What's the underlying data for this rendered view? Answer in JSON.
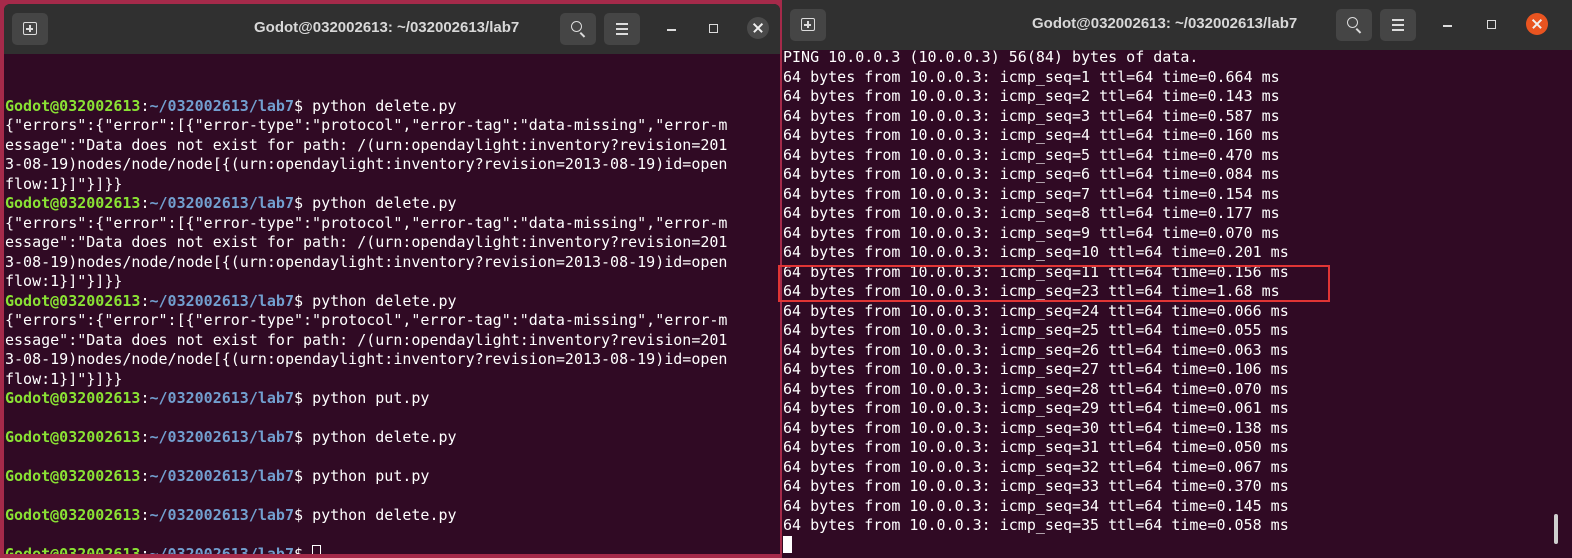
{
  "left_window": {
    "title": "Godot@032002613: ~/032002613/lab7",
    "prompt_user": "Godot@032002613",
    "prompt_sep": ":",
    "prompt_path": "~/032002613/lab7",
    "prompt_suffix": "$ ",
    "lines": [
      {
        "kind": "blank"
      },
      {
        "kind": "prompt",
        "cmd": "python delete.py"
      },
      {
        "kind": "output",
        "text": "{\"errors\":{\"error\":[{\"error-type\":\"protocol\",\"error-tag\":\"data-missing\",\"error-m"
      },
      {
        "kind": "output",
        "text": "essage\":\"Data does not exist for path: /(urn:opendaylight:inventory?revision=201"
      },
      {
        "kind": "output",
        "text": "3-08-19)nodes/node/node[{(urn:opendaylight:inventory?revision=2013-08-19)id=open"
      },
      {
        "kind": "output",
        "text": "flow:1}]\"}]}}"
      },
      {
        "kind": "prompt",
        "cmd": "python delete.py"
      },
      {
        "kind": "output",
        "text": "{\"errors\":{\"error\":[{\"error-type\":\"protocol\",\"error-tag\":\"data-missing\",\"error-m"
      },
      {
        "kind": "output",
        "text": "essage\":\"Data does not exist for path: /(urn:opendaylight:inventory?revision=201"
      },
      {
        "kind": "output",
        "text": "3-08-19)nodes/node/node[{(urn:opendaylight:inventory?revision=2013-08-19)id=open"
      },
      {
        "kind": "output",
        "text": "flow:1}]\"}]}}"
      },
      {
        "kind": "prompt",
        "cmd": "python delete.py"
      },
      {
        "kind": "output",
        "text": "{\"errors\":{\"error\":[{\"error-type\":\"protocol\",\"error-tag\":\"data-missing\",\"error-m"
      },
      {
        "kind": "output",
        "text": "essage\":\"Data does not exist for path: /(urn:opendaylight:inventory?revision=201"
      },
      {
        "kind": "output",
        "text": "3-08-19)nodes/node/node[{(urn:opendaylight:inventory?revision=2013-08-19)id=open"
      },
      {
        "kind": "output",
        "text": "flow:1}]\"}]}}"
      },
      {
        "kind": "prompt",
        "cmd": "python put.py"
      },
      {
        "kind": "blank"
      },
      {
        "kind": "prompt",
        "cmd": "python delete.py"
      },
      {
        "kind": "blank"
      },
      {
        "kind": "prompt",
        "cmd": "python put.py"
      },
      {
        "kind": "blank"
      },
      {
        "kind": "prompt",
        "cmd": "python delete.py"
      },
      {
        "kind": "blank"
      },
      {
        "kind": "prompt",
        "cmd": "",
        "cursor": true
      }
    ]
  },
  "right_window": {
    "title": "Godot@032002613: ~/032002613/lab7",
    "lines": [
      "PING 10.0.0.3 (10.0.0.3) 56(84) bytes of data.",
      "64 bytes from 10.0.0.3: icmp_seq=1 ttl=64 time=0.664 ms",
      "64 bytes from 10.0.0.3: icmp_seq=2 ttl=64 time=0.143 ms",
      "64 bytes from 10.0.0.3: icmp_seq=3 ttl=64 time=0.587 ms",
      "64 bytes from 10.0.0.3: icmp_seq=4 ttl=64 time=0.160 ms",
      "64 bytes from 10.0.0.3: icmp_seq=5 ttl=64 time=0.470 ms",
      "64 bytes from 10.0.0.3: icmp_seq=6 ttl=64 time=0.084 ms",
      "64 bytes from 10.0.0.3: icmp_seq=7 ttl=64 time=0.154 ms",
      "64 bytes from 10.0.0.3: icmp_seq=8 ttl=64 time=0.177 ms",
      "64 bytes from 10.0.0.3: icmp_seq=9 ttl=64 time=0.070 ms",
      "64 bytes from 10.0.0.3: icmp_seq=10 ttl=64 time=0.201 ms",
      "64 bytes from 10.0.0.3: icmp_seq=11 ttl=64 time=0.156 ms",
      "64 bytes from 10.0.0.3: icmp_seq=23 ttl=64 time=1.68 ms",
      "64 bytes from 10.0.0.3: icmp_seq=24 ttl=64 time=0.066 ms",
      "64 bytes from 10.0.0.3: icmp_seq=25 ttl=64 time=0.055 ms",
      "64 bytes from 10.0.0.3: icmp_seq=26 ttl=64 time=0.063 ms",
      "64 bytes from 10.0.0.3: icmp_seq=27 ttl=64 time=0.106 ms",
      "64 bytes from 10.0.0.3: icmp_seq=28 ttl=64 time=0.070 ms",
      "64 bytes from 10.0.0.3: icmp_seq=29 ttl=64 time=0.061 ms",
      "64 bytes from 10.0.0.3: icmp_seq=30 ttl=64 time=0.138 ms",
      "64 bytes from 10.0.0.3: icmp_seq=31 ttl=64 time=0.050 ms",
      "64 bytes from 10.0.0.3: icmp_seq=32 ttl=64 time=0.067 ms",
      "64 bytes from 10.0.0.3: icmp_seq=33 ttl=64 time=0.370 ms",
      "64 bytes from 10.0.0.3: icmp_seq=34 ttl=64 time=0.145 ms",
      "64 bytes from 10.0.0.3: icmp_seq=35 ttl=64 time=0.058 ms"
    ],
    "highlight_color": "#e03535"
  },
  "colors": {
    "terminal_bg": "#300a24",
    "titlebar_bg": "#303030",
    "prompt_user": "#8ae234",
    "prompt_path": "#729fcf",
    "close_active": "#e95420"
  }
}
